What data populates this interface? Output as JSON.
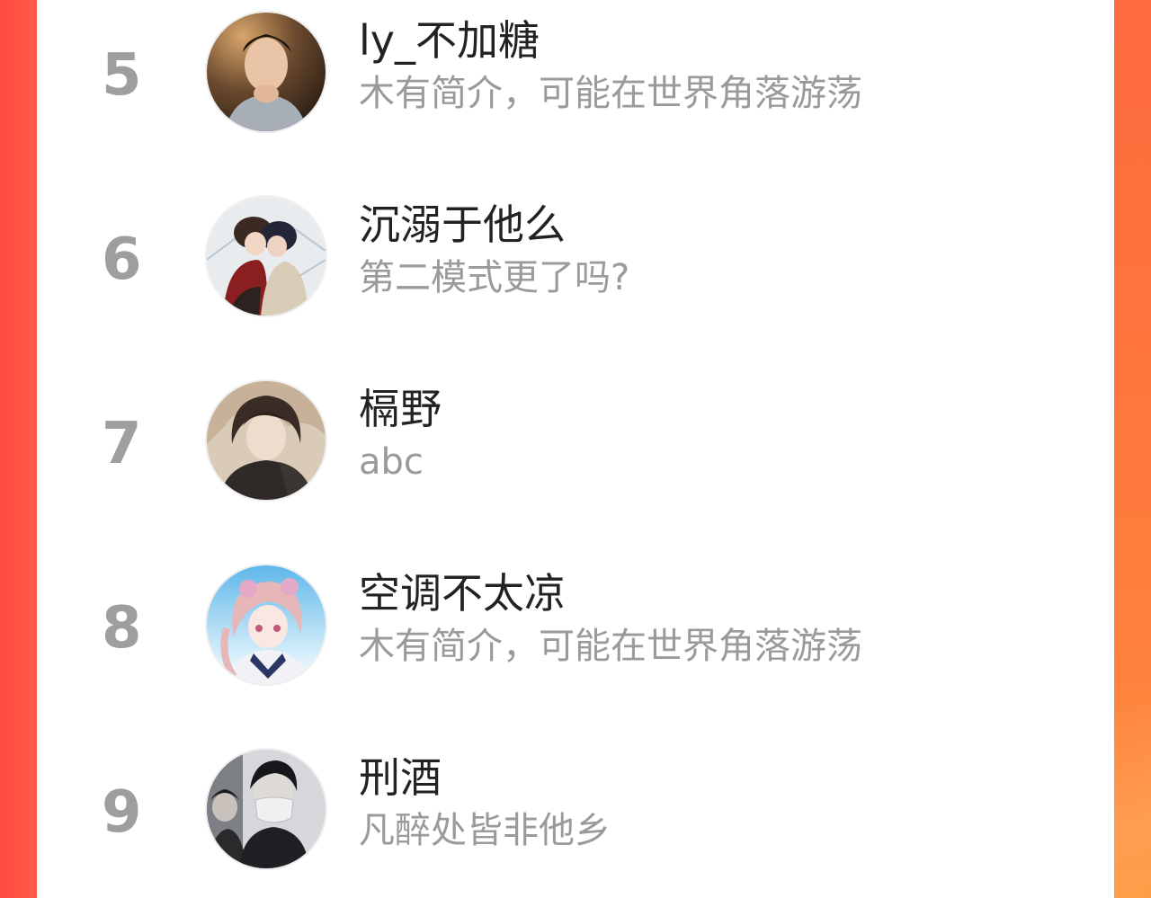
{
  "ranking": {
    "items": [
      {
        "rank": "5",
        "name": "ly_不加糖",
        "bio": "木有简介，可能在世界角落游荡",
        "avatar": "portrait-photo-avatar"
      },
      {
        "rank": "6",
        "name": "沉溺于他么",
        "bio": "第二模式更了吗?",
        "avatar": "anime-couple-avatar"
      },
      {
        "rank": "7",
        "name": "槅野",
        "bio": "abc",
        "avatar": "anime-dark-hair-avatar"
      },
      {
        "rank": "8",
        "name": "空调不太凉",
        "bio": "木有简介，可能在世界角落游荡",
        "avatar": "anime-girl-pink-hair-avatar"
      },
      {
        "rank": "9",
        "name": "刑酒",
        "bio": "凡醉处皆非他乡",
        "avatar": "masked-person-photo-avatar"
      }
    ]
  },
  "colors": {
    "background_left": "#ff4a45",
    "background_right": "#ff8a3f",
    "rank_number": "#9e9e9e",
    "name_text": "#222222",
    "bio_text": "#9a9a9a"
  }
}
